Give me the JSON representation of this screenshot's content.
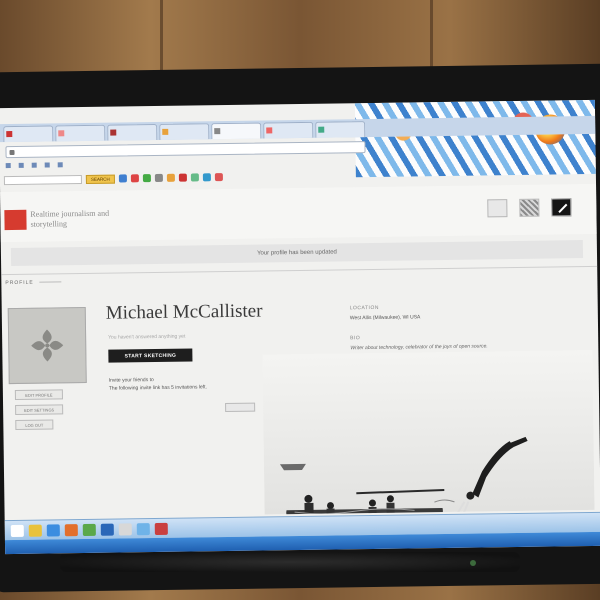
{
  "browser": {
    "tabs": [
      "",
      "",
      "",
      "",
      "",
      "",
      "",
      "",
      "",
      ""
    ],
    "url": "",
    "bookmarks": [
      "",
      "",
      "",
      "",
      "",
      "",
      ""
    ],
    "toolbar": {
      "search_placeholder": "",
      "search_button": "SEARCH"
    }
  },
  "site": {
    "logo_text": "",
    "tagline": "Realtime journalism and storytelling",
    "header_icons": [
      "",
      "",
      ""
    ]
  },
  "notice": "Your profile has been updated",
  "profile": {
    "section_label": "PROFILE",
    "name": "Michael McCallister",
    "no_answers_text": "You haven't answered anything yet",
    "sketch_button": "START SKETCHING",
    "invite_line1": "Invite your friends to",
    "invite_line2": "The following invite link has 5 invitations left.",
    "invite_link": "",
    "copy_button": "",
    "side_buttons": [
      "EDIT PROFILE",
      "EDIT SETTINGS",
      "LOG OUT"
    ],
    "location_label": "LOCATION",
    "location_value": "West Allis (Milwaukee), WI USA",
    "bio_label": "BIO",
    "bio_value": "Writer about technology, celebrator of the joys of open source."
  },
  "taskbar": {
    "clock_time": "",
    "clock_date": ""
  },
  "colors": {
    "brand_red": "#d63b2f",
    "sketch_button_bg": "#1e1e1e",
    "taskbar_blue": "#9cc3e8"
  },
  "icons": [
    "avatar-ornament-icon",
    "firefox-icon",
    "lock-icon",
    "edit-pencil-icon"
  ]
}
